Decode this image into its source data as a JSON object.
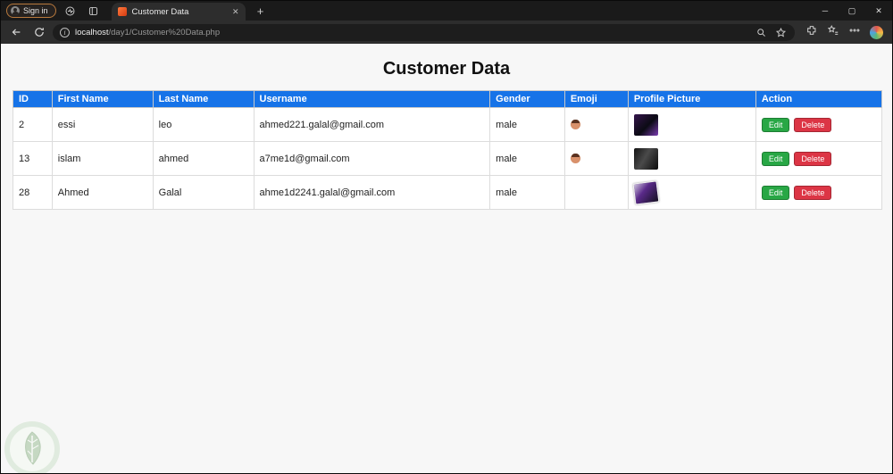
{
  "browser": {
    "signin_label": "Sign in",
    "tab_title": "Customer Data",
    "new_tab_label": "+",
    "url_host": "localhost",
    "url_path": "/day1/Customer%20Data.php",
    "window_controls": {
      "minimize": "─",
      "maximize": "▢",
      "close": "✕"
    }
  },
  "page": {
    "title": "Customer Data",
    "table": {
      "headers": [
        "ID",
        "First Name",
        "Last Name",
        "Username",
        "Gender",
        "Emoji",
        "Profile Picture",
        "Action"
      ],
      "edit_label": "Edit",
      "delete_label": "Delete",
      "rows": [
        {
          "id": "2",
          "first_name": "essi",
          "last_name": "leo",
          "username": "ahmed221.galal@gmail.com",
          "gender": "male",
          "emoji": "face-emoji",
          "profile_picture": "photo-thumbnail"
        },
        {
          "id": "13",
          "first_name": "islam",
          "last_name": "ahmed",
          "username": "a7me1d@gmail.com",
          "gender": "male",
          "emoji": "face-emoji",
          "profile_picture": "photo-thumbnail"
        },
        {
          "id": "28",
          "first_name": "Ahmed",
          "last_name": "Galal",
          "username": "ahme1d2241.galal@gmail.com",
          "gender": "male",
          "emoji": "",
          "profile_picture": "photo-thumbnail"
        }
      ]
    }
  },
  "colors": {
    "header_blue": "#1673e8",
    "edit_green": "#28a745",
    "delete_red": "#dc3545",
    "chrome_dark": "#1a1a1a",
    "toolbar_dark": "#2d2d2d"
  }
}
